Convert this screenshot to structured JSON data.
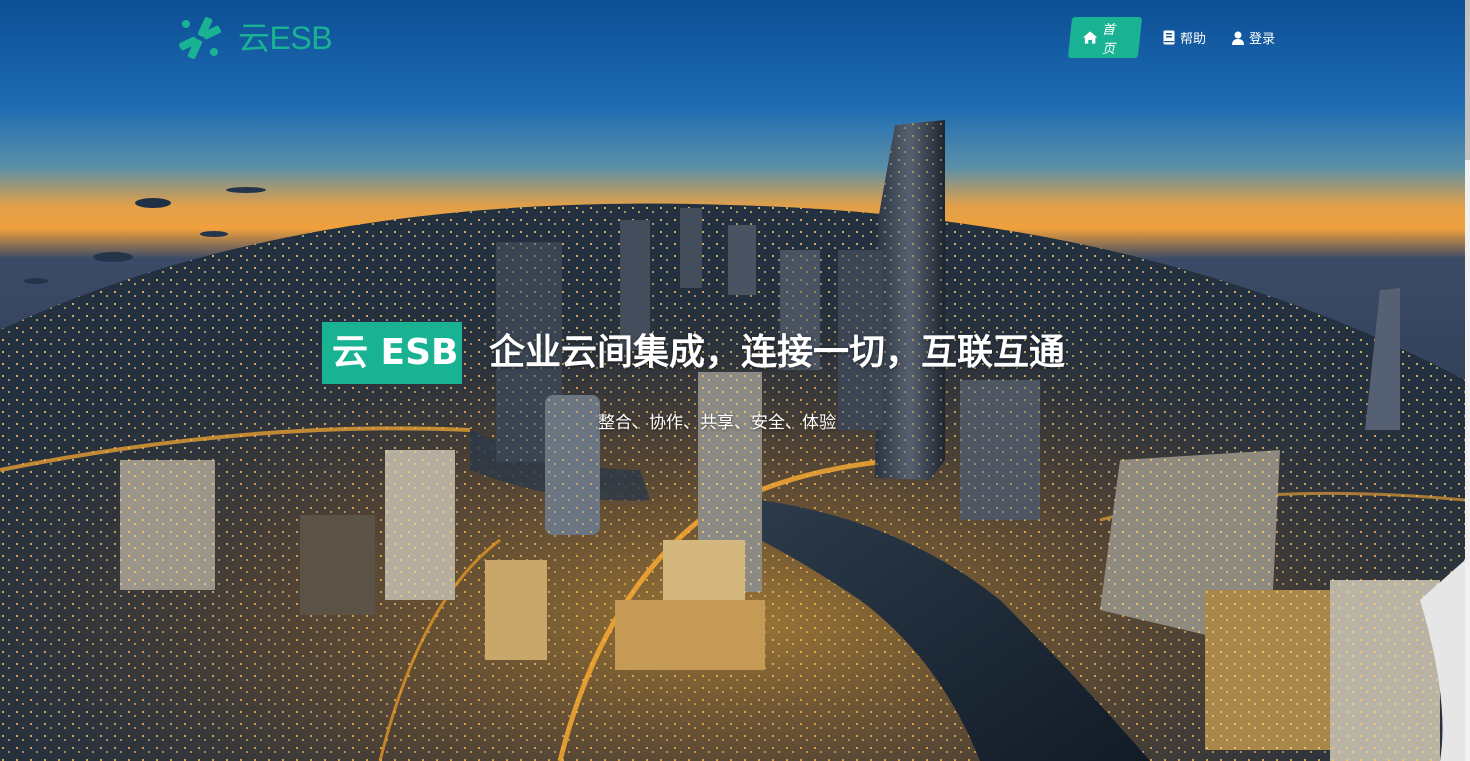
{
  "header": {
    "logo_text": "云ESB",
    "logo_color": "#19b394"
  },
  "nav": {
    "items": [
      {
        "label": "首页",
        "icon": "home-icon",
        "active": true
      },
      {
        "label": "帮助",
        "icon": "book-icon",
        "active": false
      },
      {
        "label": "登录",
        "icon": "user-icon",
        "active": false
      }
    ],
    "active_color": "#19b394"
  },
  "hero": {
    "badge": "云 ESB",
    "headline": "企业云间集成，连接一切，互联互通",
    "subtitle": "整合、协作、共享、安全、体验",
    "background": "night-city-fisheye-photo"
  }
}
